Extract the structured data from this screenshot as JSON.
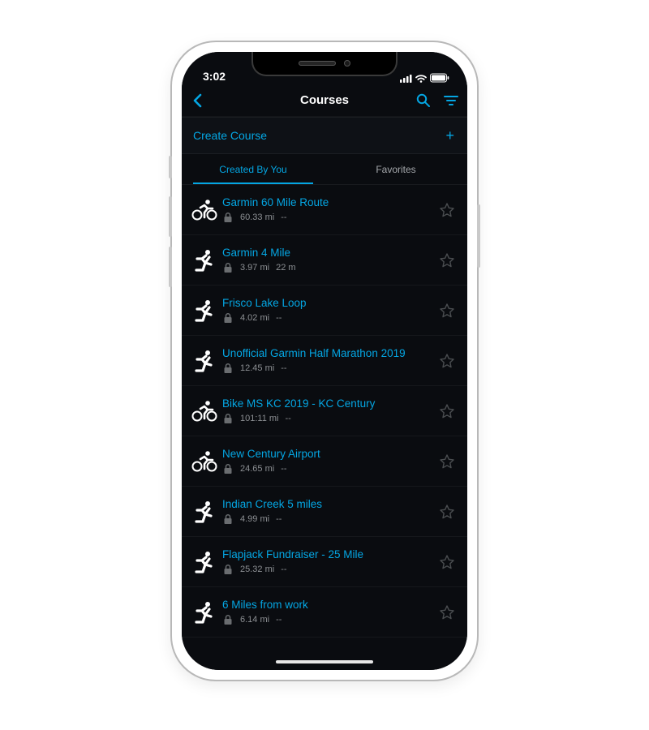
{
  "status": {
    "time": "3:02"
  },
  "nav": {
    "title": "Courses"
  },
  "create": {
    "label": "Create Course",
    "plus": "+"
  },
  "tabs": {
    "created": "Created By You",
    "favorites": "Favorites",
    "active": "created"
  },
  "icons": {
    "bike": "bike-icon",
    "run": "run-icon"
  },
  "courses": [
    {
      "title": "Garmin 60 Mile Route",
      "distance": "60.33 mi",
      "duration": "--",
      "type": "bike"
    },
    {
      "title": "Garmin 4 Mile",
      "distance": "3.97 mi",
      "duration": "22 m",
      "type": "run"
    },
    {
      "title": "Frisco Lake Loop",
      "distance": "4.02 mi",
      "duration": "--",
      "type": "run"
    },
    {
      "title": "Unofficial Garmin Half Marathon 2019",
      "distance": "12.45 mi",
      "duration": "--",
      "type": "run"
    },
    {
      "title": "Bike MS KC 2019 - KC Century",
      "distance": "101:11 mi",
      "duration": "--",
      "type": "bike"
    },
    {
      "title": "New Century Airport",
      "distance": "24.65 mi",
      "duration": "--",
      "type": "bike"
    },
    {
      "title": "Indian Creek 5 miles",
      "distance": "4.99 mi",
      "duration": "--",
      "type": "run"
    },
    {
      "title": "Flapjack Fundraiser - 25 Mile",
      "distance": "25.32 mi",
      "duration": "--",
      "type": "run"
    },
    {
      "title": "6 Miles from work",
      "distance": "6.14 mi",
      "duration": "--",
      "type": "run"
    }
  ]
}
